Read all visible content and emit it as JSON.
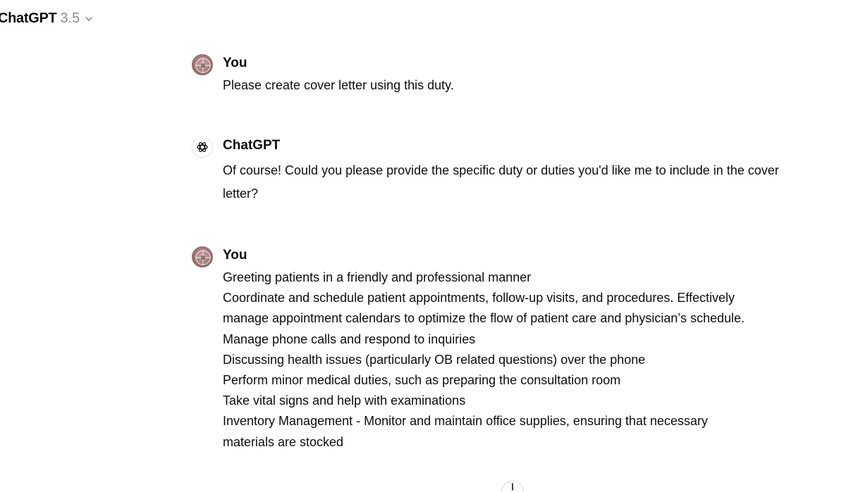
{
  "header": {
    "model_name": "ChatGPT",
    "model_version": "3.5",
    "chevron_icon": "chevron-down-icon"
  },
  "messages": [
    {
      "author": "You",
      "role": "user",
      "lines": [
        "Please create cover letter using this duty."
      ]
    },
    {
      "author": "ChatGPT",
      "role": "assistant",
      "lines": [
        "Of course! Could you please provide the specific duty or duties you'd like me to include in the cover",
        "letter?"
      ]
    },
    {
      "author": "You",
      "role": "user",
      "lines": [
        "Greeting patients in a friendly and professional manner",
        "Coordinate and schedule patient appointments, follow-up visits, and procedures. Effectively",
        "manage appointment calendars to optimize the flow of patient care and physician’s schedule.",
        "Manage phone calls and respond to inquiries",
        "Discussing health issues (particularly OB related questions) over the phone",
        "Perform minor medical duties, such as preparing the consultation room",
        "Take vital signs and help with examinations",
        "Inventory Management - Monitor and maintain office supplies, ensuring that necessary",
        "materials are stocked"
      ]
    }
  ],
  "icons": {
    "user_avatar": "user-avatar",
    "assistant_avatar": "openai-logo-icon",
    "scroll_down": "arrow-down-icon"
  },
  "colors": {
    "text": "#0d0d0d",
    "muted": "#8e8e8e",
    "background": "#ffffff"
  }
}
